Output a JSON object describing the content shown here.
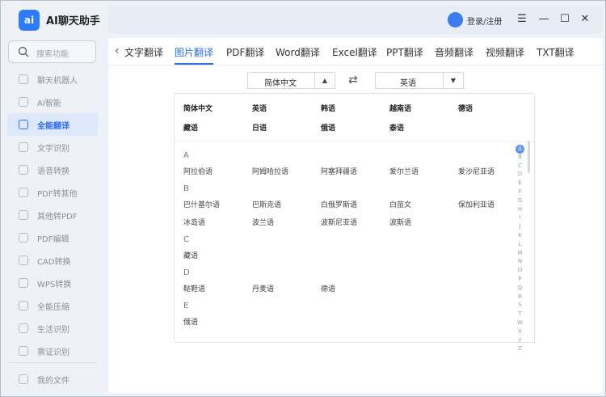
{
  "app": {
    "logo_text": "ai",
    "title": "AI聊天助手"
  },
  "search": {
    "placeholder": "搜索功能"
  },
  "sidebar": {
    "items": [
      {
        "label": "聊天机器人",
        "icon": "robot-icon",
        "active": false
      },
      {
        "label": "AI智能",
        "icon": "ai-icon",
        "active": false
      },
      {
        "label": "全能翻译",
        "icon": "translate-icon",
        "active": true
      },
      {
        "label": "文字识别",
        "icon": "ocr-icon",
        "active": false
      },
      {
        "label": "语音转换",
        "icon": "voice-icon",
        "active": false
      },
      {
        "label": "PDF转其他",
        "icon": "pdf-icon",
        "active": false
      },
      {
        "label": "其他转PDF",
        "icon": "to-pdf-icon",
        "active": false
      },
      {
        "label": "PDF编辑",
        "icon": "pdf-edit-icon",
        "active": false
      },
      {
        "label": "CAD转换",
        "icon": "cad-icon",
        "active": false
      },
      {
        "label": "WPS转换",
        "icon": "wps-icon",
        "active": false
      },
      {
        "label": "全能压缩",
        "icon": "compress-icon",
        "active": false
      },
      {
        "label": "生活识别",
        "icon": "life-icon",
        "active": false
      },
      {
        "label": "票证识别",
        "icon": "ticket-icon",
        "active": false
      }
    ],
    "bottom": {
      "label": "我的文件",
      "icon": "folder-icon"
    }
  },
  "topbar": {
    "login": "登录/注册",
    "menu_icon": "menu-icon",
    "minimize_icon": "minimize-icon",
    "maximize_icon": "maximize-icon",
    "close_icon": "close-icon"
  },
  "tabs": [
    "文字翻译",
    "图片翻译",
    "PDF翻译",
    "Word翻译",
    "Excel翻译",
    "PPT翻译",
    "音频翻译",
    "视频翻译",
    "TXT翻译"
  ],
  "active_tab": "图片翻译",
  "source_lang": "简体中文",
  "target_lang": "英语",
  "common_langs": [
    [
      "简体中文",
      "英语",
      "韩语",
      "越南语",
      "德语"
    ],
    [
      "藏语",
      "日语",
      "俄语",
      "泰语"
    ]
  ],
  "groups": [
    {
      "letter": "A",
      "rows": [
        [
          "阿拉伯语",
          "阿姆哈拉语",
          "阿塞拜疆语",
          "爱尔兰语",
          "爱沙尼亚语"
        ]
      ]
    },
    {
      "letter": "B",
      "rows": [
        [
          "巴什基尔语",
          "巴斯克语",
          "白俄罗斯语",
          "白苗文",
          "保加利亚语"
        ],
        [
          "冰岛语",
          "波兰语",
          "波斯尼亚语",
          "波斯语"
        ]
      ]
    },
    {
      "letter": "C",
      "rows": [
        [
          "藏语"
        ]
      ]
    },
    {
      "letter": "D",
      "rows": [
        [
          "鞑靼语",
          "丹麦语",
          "德语"
        ]
      ]
    },
    {
      "letter": "E",
      "rows": [
        [
          "俄语"
        ]
      ]
    }
  ],
  "az_index": [
    "A",
    "B",
    "C",
    "D",
    "E",
    "F",
    "G",
    "H",
    "I",
    "J",
    "K",
    "L",
    "M",
    "N",
    "O",
    "P",
    "Q",
    "R",
    "S",
    "T",
    "W",
    "X",
    "Y",
    "Z"
  ]
}
